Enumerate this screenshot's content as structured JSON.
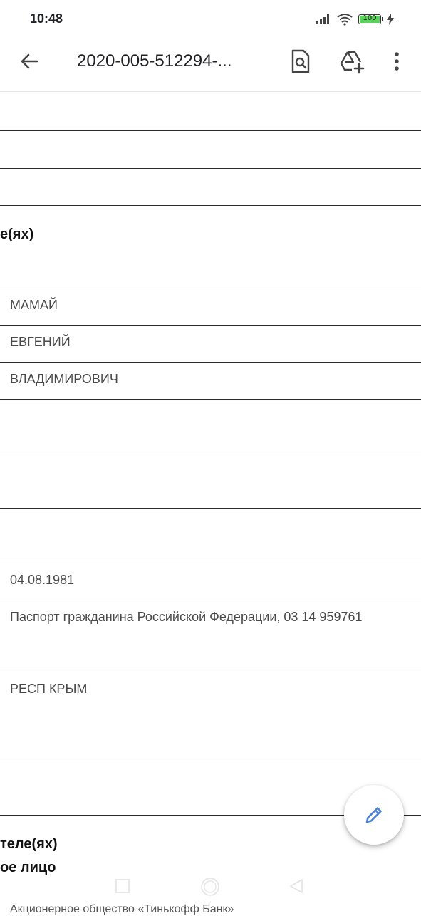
{
  "status_bar": {
    "time": "10:48",
    "battery_level": "100",
    "battery_fraction": 1.0
  },
  "toolbar": {
    "title": "2020-005-512294-...",
    "icons": [
      "back-arrow-icon",
      "find-in-page-icon",
      "add-to-drive-icon",
      "more-vert-icon"
    ]
  },
  "document": {
    "section_heading_1": "е(ях)",
    "last_name": "МАМАЙ",
    "first_name": "ЕВГЕНИЙ",
    "patronymic": "ВЛАДИМИРОВИЧ",
    "birth_date": "04.08.1981",
    "identity_document": "Паспорт гражданина Российской Федерации, 03 14 959761",
    "region": "РЕСП КРЫМ",
    "section_heading_2_line1": "теле(ях)",
    "section_heading_2_line2": "ое лицо",
    "bottom_text": "Акционерное общество «Тинькофф Банк»"
  },
  "fab": {
    "icon": "edit-pencil-icon"
  },
  "colors": {
    "accent": "#4a80d9",
    "battery_fill": "#5bd45b",
    "rule_dark": "#2b2b2b",
    "rule_light": "#9a9a9a",
    "cell_text": "#4a4a4a"
  }
}
